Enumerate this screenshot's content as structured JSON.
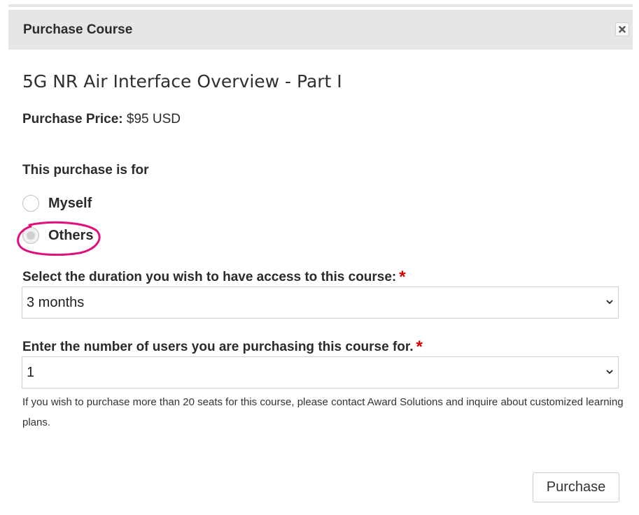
{
  "modal": {
    "title": "Purchase Course",
    "close_icon": "close-icon"
  },
  "course": {
    "title": "5G NR Air Interface Overview - Part I"
  },
  "price": {
    "label": "Purchase Price:",
    "value": "$95 USD"
  },
  "purchase_for": {
    "heading": "This purchase is for",
    "options": [
      {
        "label": "Myself",
        "selected": false
      },
      {
        "label": "Others",
        "selected": true
      }
    ]
  },
  "duration": {
    "label": "Select the duration you wish to have access to this course:",
    "required_mark": "*",
    "selected": "3 months"
  },
  "users": {
    "label": "Enter the number of users you are purchasing this course for.",
    "required_mark": "*",
    "selected": "1",
    "help": "If you wish to purchase more than 20 seats for this course, please contact Award Solutions and inquire about customized learning plans."
  },
  "actions": {
    "purchase_label": "Purchase"
  },
  "colors": {
    "header_bg": "#e6e6e6",
    "required": "#d40000",
    "annotation": "#e0107a"
  }
}
